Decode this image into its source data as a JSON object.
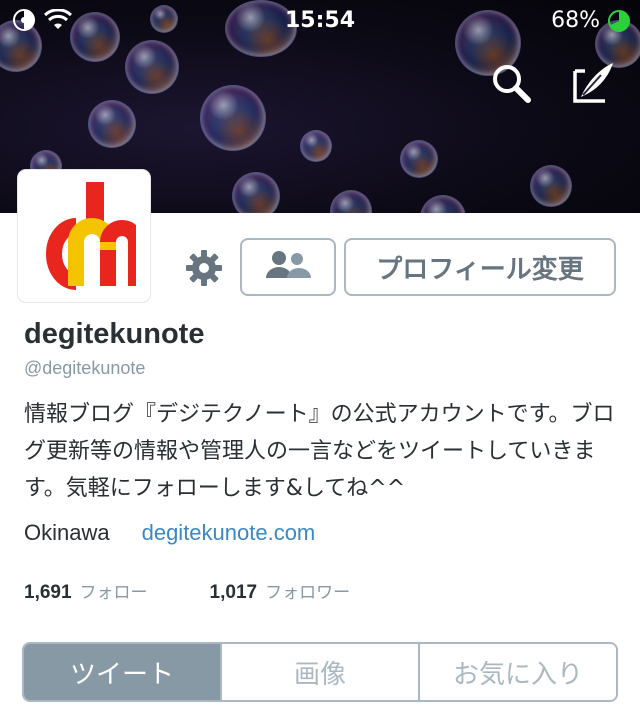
{
  "status_bar": {
    "time": "15:54",
    "battery": "68%",
    "icons": [
      "do-not-disturb-icon",
      "wifi-icon",
      "battery-icon"
    ]
  },
  "header": {
    "icons": [
      "search-icon",
      "compose-tweet-icon"
    ]
  },
  "profile": {
    "name": "degitekunote",
    "handle": "@degitekunote",
    "bio": "情報ブログ『デジテクノート』の公式アカウントです。ブログ更新等の情報や管理人の一言などをツイートしていきます。気軽にフォローします&してね^^",
    "location": "Okinawa",
    "url": "degitekunote.com",
    "avatar_colors": {
      "red": "#e8261e",
      "yellow": "#f5c400"
    }
  },
  "actions": {
    "settings_icon": "gear-icon",
    "follow_icon": "people-icon",
    "edit_profile_label": "プロフィール変更"
  },
  "stats": [
    {
      "count": "1,691",
      "label": "フォロー"
    },
    {
      "count": "1,017",
      "label": "フォロワー"
    }
  ],
  "tabs": [
    {
      "label": "ツイート",
      "active": true
    },
    {
      "label": "画像",
      "active": false
    },
    {
      "label": "お気に入り",
      "active": false
    }
  ],
  "colors": {
    "accent_link": "#3b88c3",
    "muted": "#8899a6",
    "border": "#aab8c2",
    "battery_green": "#2bd13b"
  }
}
